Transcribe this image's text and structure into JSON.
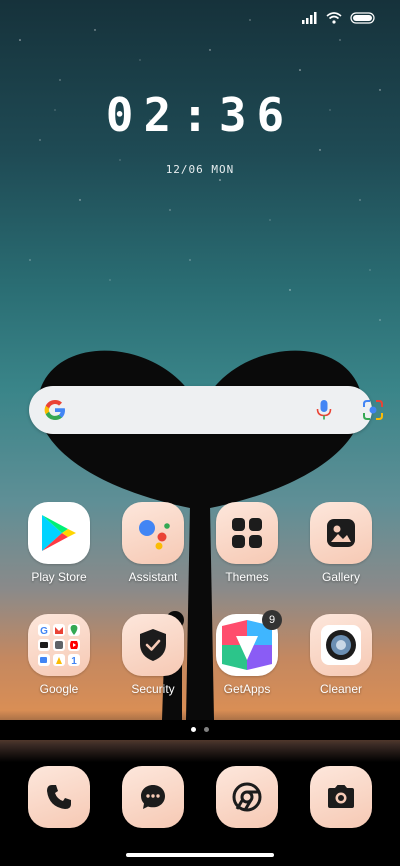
{
  "lock": {
    "time": "02:36",
    "date": "12/06 MON"
  },
  "search": {
    "engine_icon": "google-g-icon",
    "mic_icon": "mic-icon",
    "lens_icon": "lens-camera-icon"
  },
  "apps": [
    {
      "label": "Play Store"
    },
    {
      "label": "Assistant"
    },
    {
      "label": "Themes"
    },
    {
      "label": "Gallery"
    },
    {
      "label": "Google"
    },
    {
      "label": "Security"
    },
    {
      "label": "GetApps",
      "badge": "9"
    },
    {
      "label": "Cleaner"
    }
  ],
  "dock": [
    {
      "icon": "phone-icon"
    },
    {
      "icon": "messages-icon"
    },
    {
      "icon": "chrome-icon"
    },
    {
      "icon": "camera-icon"
    }
  ],
  "pager": {
    "pages": 2,
    "active": 1
  },
  "colors": {
    "tile_top": "#fde7dc",
    "tile_bottom": "#f6c9b4",
    "icon_dark": "#1c1c1c"
  }
}
